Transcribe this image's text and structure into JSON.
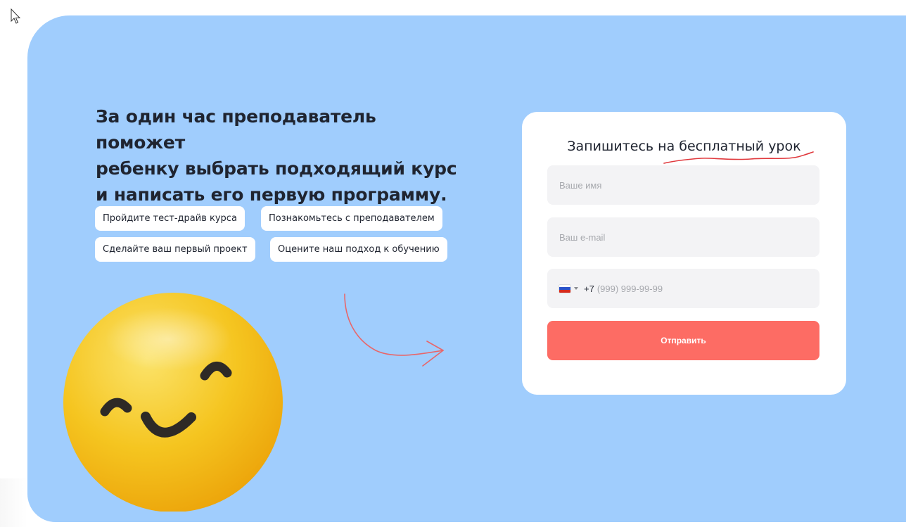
{
  "hero": {
    "headline_lines": [
      "За один час преподаватель поможет",
      "ребенку выбрать подходящий курс",
      "и написать его первую программу."
    ],
    "chips": [
      "Пройдите тест-драйв курса",
      "Познакомьтесь с преподавателем",
      "Сделайте ваш первый проект",
      "Оцените наш подход к обучению"
    ]
  },
  "form": {
    "title": "Запишитесь на бесплатный урок",
    "name_placeholder": "Ваше имя",
    "email_placeholder": "Ваш e-mail",
    "phone_code": "+7",
    "phone_placeholder": "(999) 999-99-99",
    "submit_label": "Отправить"
  },
  "colors": {
    "panel_bg": "#a0cdfd",
    "accent": "#fd6c64",
    "card_bg": "#ffffff",
    "field_bg": "#f3f3f5"
  },
  "icons": [
    "cursor-icon",
    "smiley-emoji",
    "curved-arrow-icon",
    "russia-flag-icon",
    "chevron-down-icon"
  ]
}
